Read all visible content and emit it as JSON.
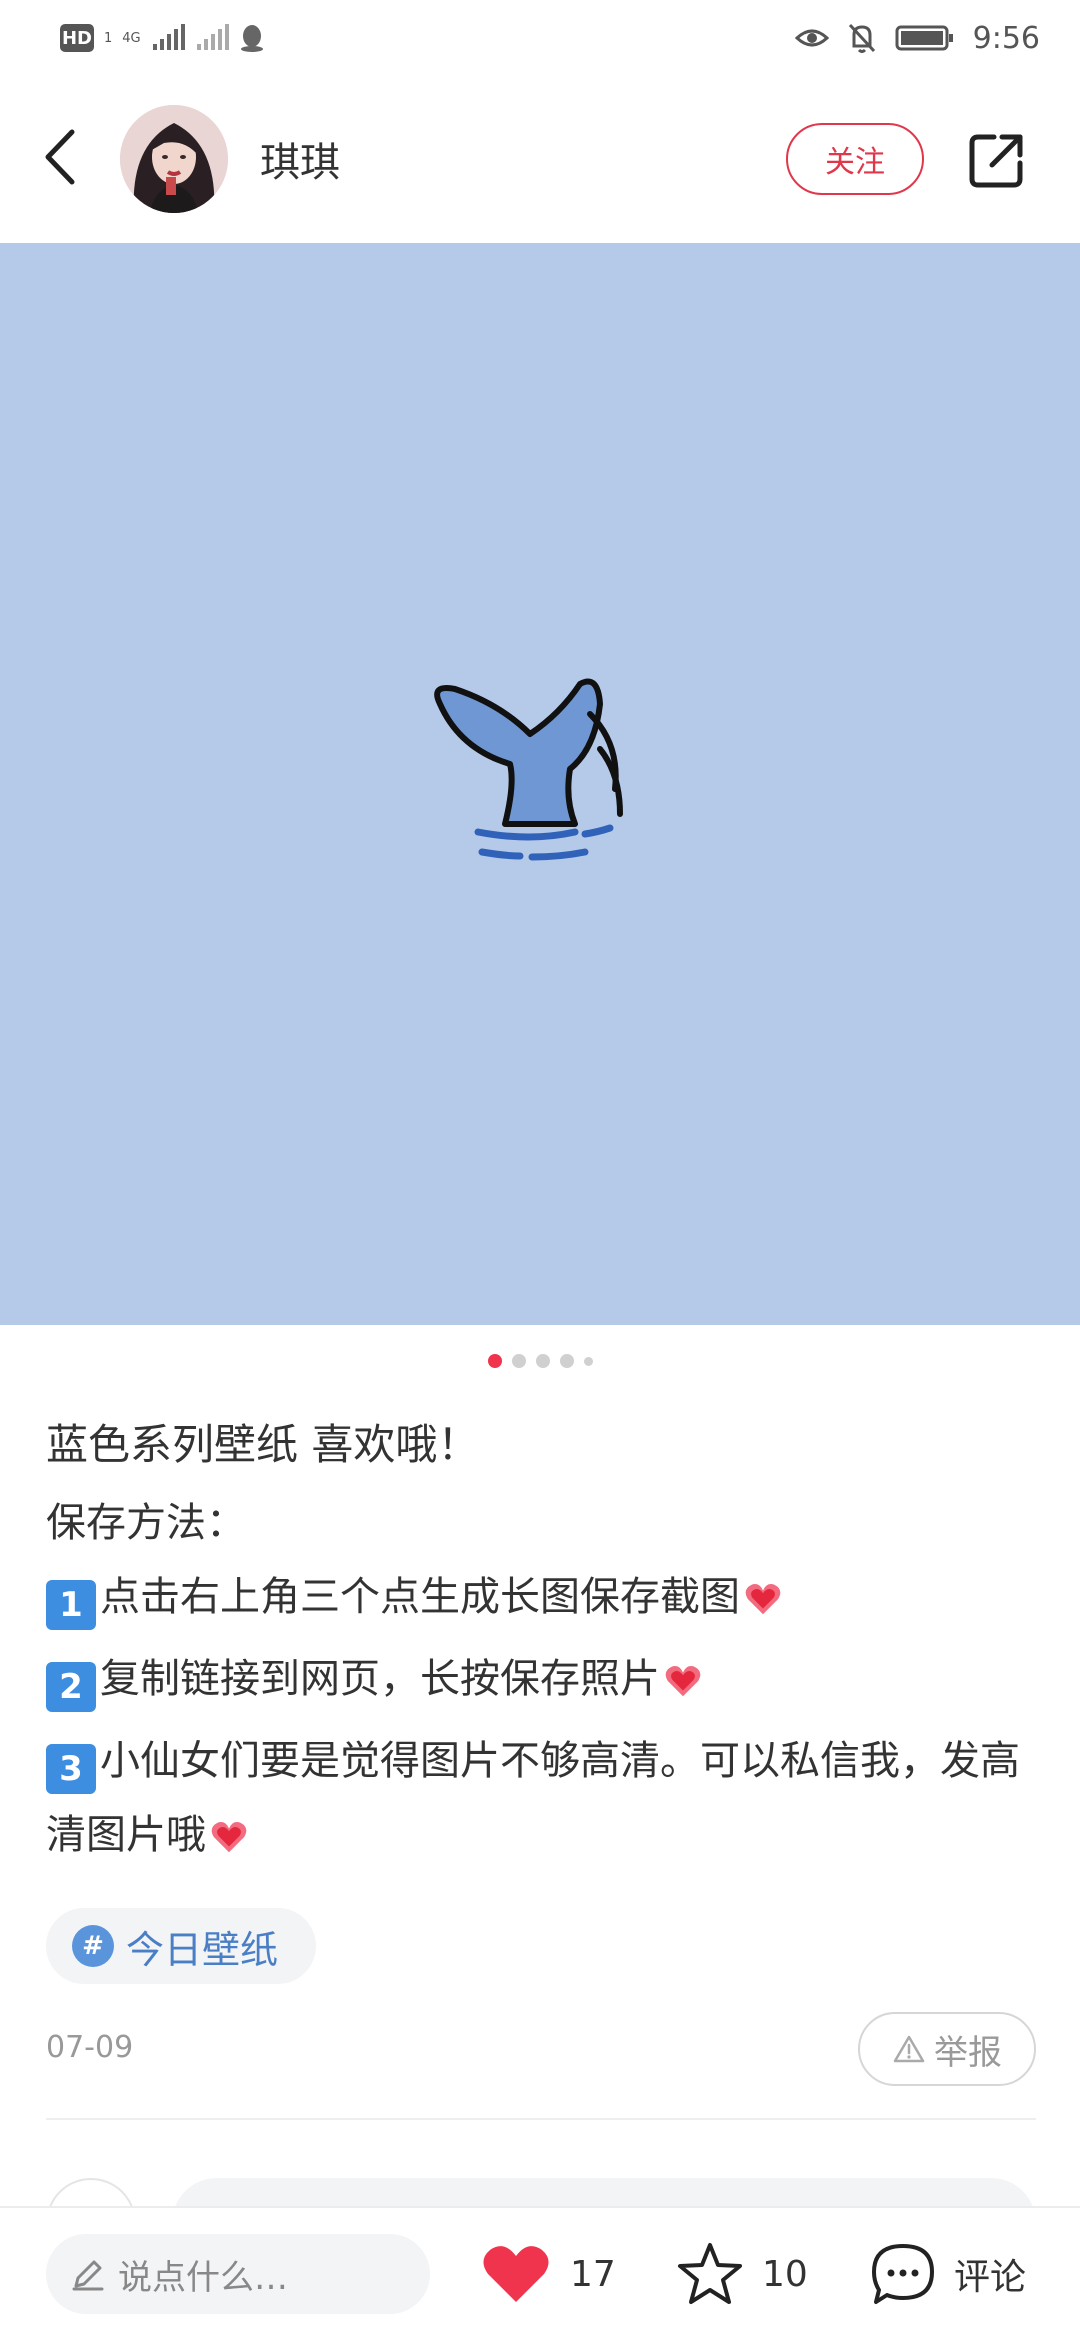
{
  "status_bar": {
    "hd_label": "HD",
    "hd_sub": "1",
    "network": "4G",
    "time": "9:56"
  },
  "header": {
    "username": "琪琪",
    "follow_label": "关注"
  },
  "post": {
    "title": "蓝色系列壁纸 喜欢哦！",
    "save_method_label": "保存方法：",
    "steps": [
      {
        "num": "1",
        "text": "点击右上角三个点生成长图保存截图"
      },
      {
        "num": "2",
        "text": "复制链接到网页，长按保存照片"
      },
      {
        "num": "3",
        "text": "小仙女们要是觉得图片不够高清。可以私信我，发高清图片哦"
      }
    ],
    "tag": {
      "hash": "#",
      "label": "今日壁纸"
    },
    "date": "07-09",
    "report_label": "举报"
  },
  "pagination": {
    "count": 5,
    "active_index": 0
  },
  "bottom_bar": {
    "comment_placeholder": "说点什么…",
    "like_count": "17",
    "star_count": "10",
    "comment_label": "评论"
  },
  "colors": {
    "accent": "#e0374a",
    "image_bg": "#b5cae9",
    "tag_text": "#4a7fc6"
  },
  "icons": [
    "back-icon",
    "share-icon",
    "warning-icon",
    "pencil-icon",
    "heart-icon",
    "star-icon",
    "comment-bubble-icon",
    "eye-icon",
    "bell-off-icon",
    "battery-icon"
  ]
}
